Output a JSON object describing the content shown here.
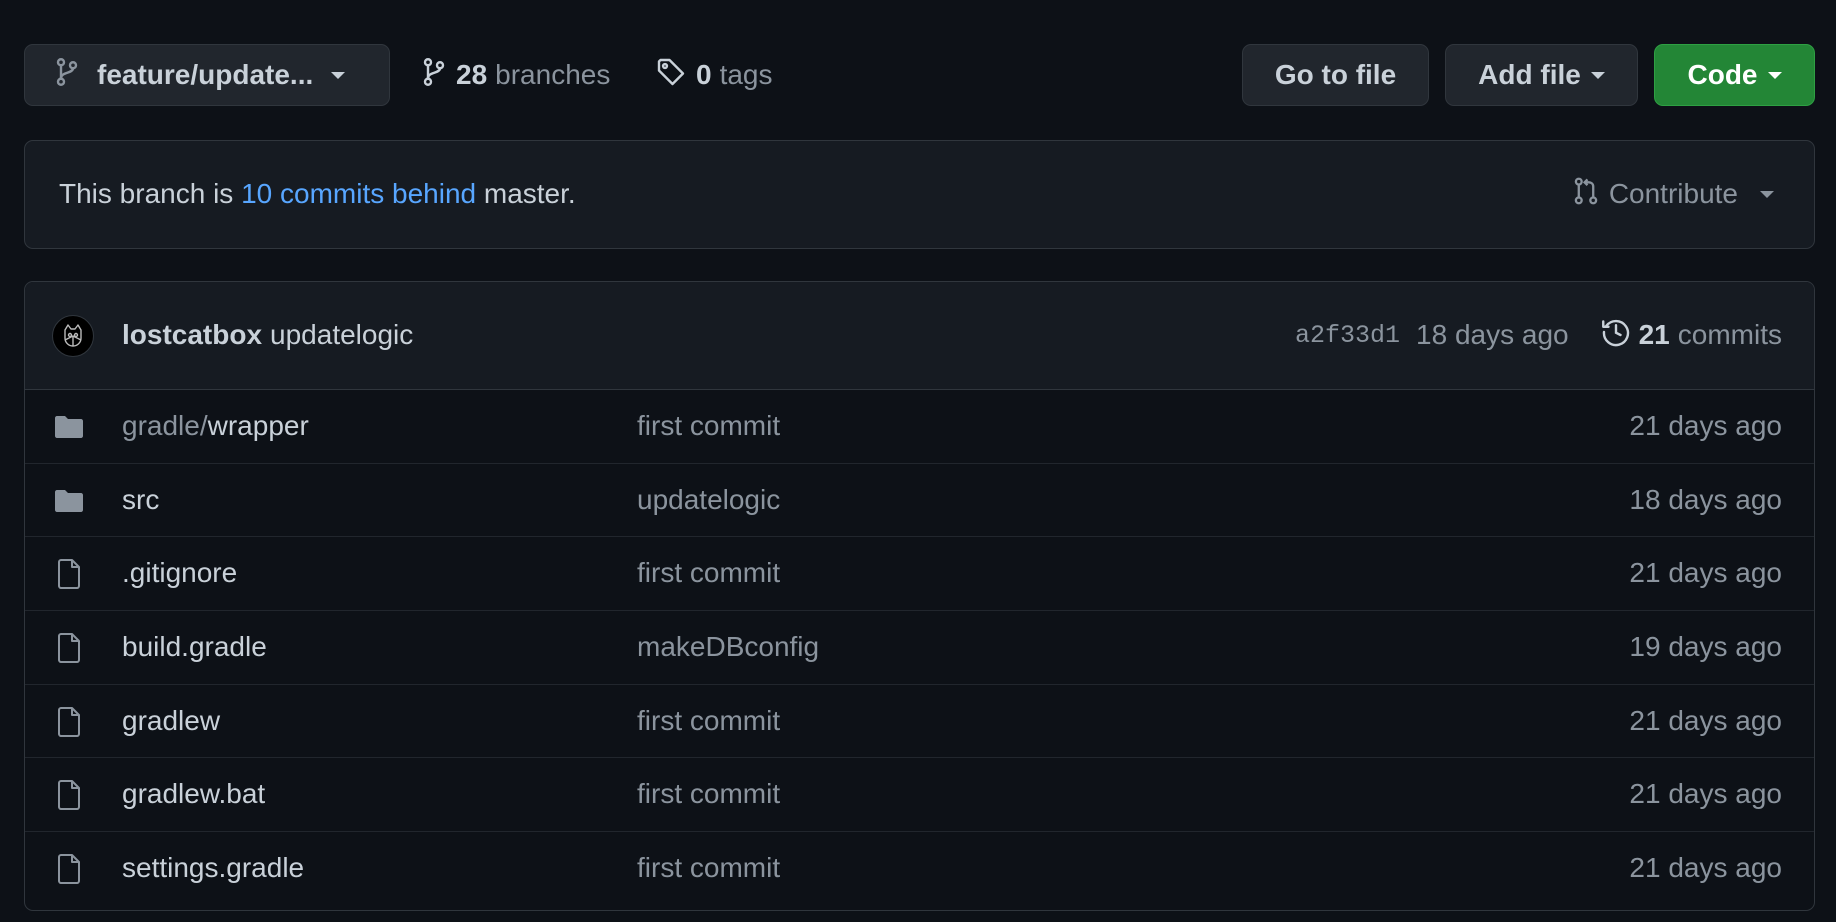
{
  "toolbar": {
    "branch_name": "feature/update...",
    "branches_count": "28",
    "branches_label": "branches",
    "tags_count": "0",
    "tags_label": "tags",
    "goto_file_label": "Go to file",
    "add_file_label": "Add file",
    "code_label": "Code"
  },
  "notice": {
    "prefix": "This branch is ",
    "link": "10 commits behind",
    "suffix": " master.",
    "contribute_label": "Contribute"
  },
  "latest_commit": {
    "author": "lostcatbox",
    "message": "updatelogic",
    "sha": "a2f33d1",
    "age": "18 days ago",
    "commits_count": "21",
    "commits_label": "commits"
  },
  "files": [
    {
      "type": "folder",
      "prefix": "gradle/",
      "name": "wrapper",
      "message": "first commit",
      "age": "21 days ago"
    },
    {
      "type": "folder",
      "prefix": "",
      "name": "src",
      "message": "updatelogic",
      "age": "18 days ago"
    },
    {
      "type": "file",
      "prefix": "",
      "name": ".gitignore",
      "message": "first commit",
      "age": "21 days ago"
    },
    {
      "type": "file",
      "prefix": "",
      "name": "build.gradle",
      "message": "makeDBconfig",
      "age": "19 days ago"
    },
    {
      "type": "file",
      "prefix": "",
      "name": "gradlew",
      "message": "first commit",
      "age": "21 days ago"
    },
    {
      "type": "file",
      "prefix": "",
      "name": "gradlew.bat",
      "message": "first commit",
      "age": "21 days ago"
    },
    {
      "type": "file",
      "prefix": "",
      "name": "settings.gradle",
      "message": "first commit",
      "age": "21 days ago"
    }
  ],
  "colors": {
    "background": "#0d1117",
    "accent_link": "#58a6ff",
    "code_button": "#238636"
  },
  "icons": {
    "branch": "git-branch-icon",
    "tag": "tag-icon",
    "contribute": "git-pull-request-icon",
    "history": "history-icon",
    "folder": "folder-icon",
    "file": "file-icon"
  }
}
